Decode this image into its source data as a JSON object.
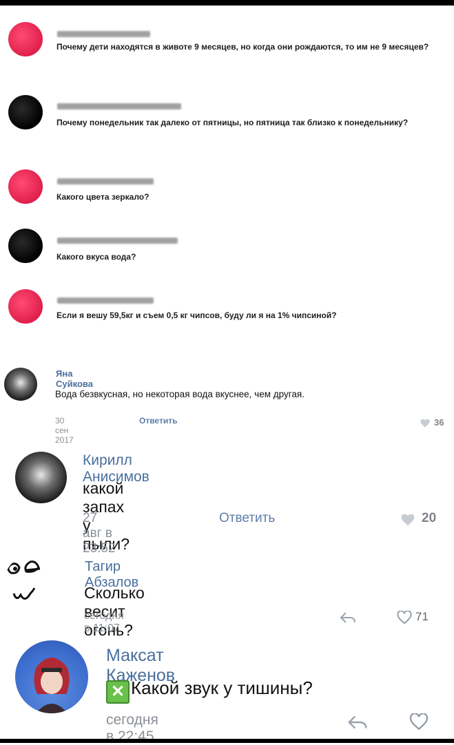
{
  "questions": [
    {
      "text": "Почему дети находятся в животе 9 месяцев, но когда они рождаются, то им не 9 месяцев?"
    },
    {
      "text": "Почему понедельник так далеко от пятницы, но пятница так близко к понедельнику?"
    },
    {
      "text": "Какого цвета зеркало?"
    },
    {
      "text": "Какого вкуса вода?"
    },
    {
      "text": "Если я вешу 59,5кг и съем 0,5 кг чипсов, буду ли я на 1% чипсиной?"
    }
  ],
  "comments": [
    {
      "name": "Яна Суйкова",
      "text": "Вода безвкусная, но некоторая вода вкуснее, чем другая.",
      "date": "30 сен 2017",
      "reply": "Ответить",
      "likes": "36"
    },
    {
      "name": "Кирилл Анисимов",
      "text": "какой запах у пыли?",
      "date": "27 авг в 23:52",
      "reply": "Ответить",
      "likes": "20"
    },
    {
      "name": "Тагир Абзалов",
      "text": "Сколько весит огонь?",
      "date": "сегодня в 11:07",
      "likes": "71"
    },
    {
      "name": "Максат Каженов",
      "emoji": "✕",
      "text": "Какой звук у тишины?",
      "date": "сегодня в 22:45"
    }
  ]
}
